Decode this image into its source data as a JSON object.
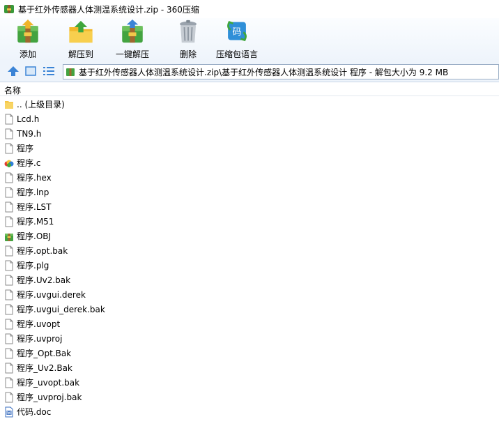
{
  "window": {
    "title": "基于红外传感器人体测温系统设计.zip - 360压缩"
  },
  "toolbar": {
    "buttons": [
      {
        "label": "添加",
        "icon": "add-archive-icon"
      },
      {
        "label": "解压到",
        "icon": "extract-to-icon"
      },
      {
        "label": "一键解压",
        "icon": "one-click-extract-icon"
      },
      {
        "label": "删除",
        "icon": "trash-icon"
      },
      {
        "label": "压缩包语言",
        "icon": "archive-language-icon"
      }
    ],
    "language_glyph": "码"
  },
  "address": {
    "path": "基于红外传感器人体测温系统设计.zip\\基于红外传感器人体测温系统设计 程序 - 解包大小为 9.2 MB"
  },
  "list": {
    "column_name": "名称",
    "items": [
      {
        "name": ".. (上级目录)",
        "icon": "folder-up-icon"
      },
      {
        "name": "Lcd.h",
        "icon": "file-icon"
      },
      {
        "name": "TN9.h",
        "icon": "file-icon"
      },
      {
        "name": "程序",
        "icon": "file-icon"
      },
      {
        "name": "程序.c",
        "icon": "c-source-icon"
      },
      {
        "name": "程序.hex",
        "icon": "file-icon"
      },
      {
        "name": "程序.lnp",
        "icon": "file-icon"
      },
      {
        "name": "程序.LST",
        "icon": "file-icon"
      },
      {
        "name": "程序.M51",
        "icon": "file-icon"
      },
      {
        "name": "程序.OBJ",
        "icon": "archive-file-icon"
      },
      {
        "name": "程序.opt.bak",
        "icon": "file-icon"
      },
      {
        "name": "程序.plg",
        "icon": "file-icon"
      },
      {
        "name": "程序.Uv2.bak",
        "icon": "file-icon"
      },
      {
        "name": "程序.uvgui.derek",
        "icon": "file-icon"
      },
      {
        "name": "程序.uvgui_derek.bak",
        "icon": "file-icon"
      },
      {
        "name": "程序.uvopt",
        "icon": "file-icon"
      },
      {
        "name": "程序.uvproj",
        "icon": "file-icon"
      },
      {
        "name": "程序_Opt.Bak",
        "icon": "file-icon"
      },
      {
        "name": "程序_Uv2.Bak",
        "icon": "file-icon"
      },
      {
        "name": "程序_uvopt.bak",
        "icon": "file-icon"
      },
      {
        "name": "程序_uvproj.bak",
        "icon": "file-icon"
      },
      {
        "name": "代码.doc",
        "icon": "word-doc-icon"
      }
    ]
  },
  "colors": {
    "accent": "#2f7fd6",
    "archive_green": "#4aa33a",
    "folder_yellow": "#f5c542"
  }
}
